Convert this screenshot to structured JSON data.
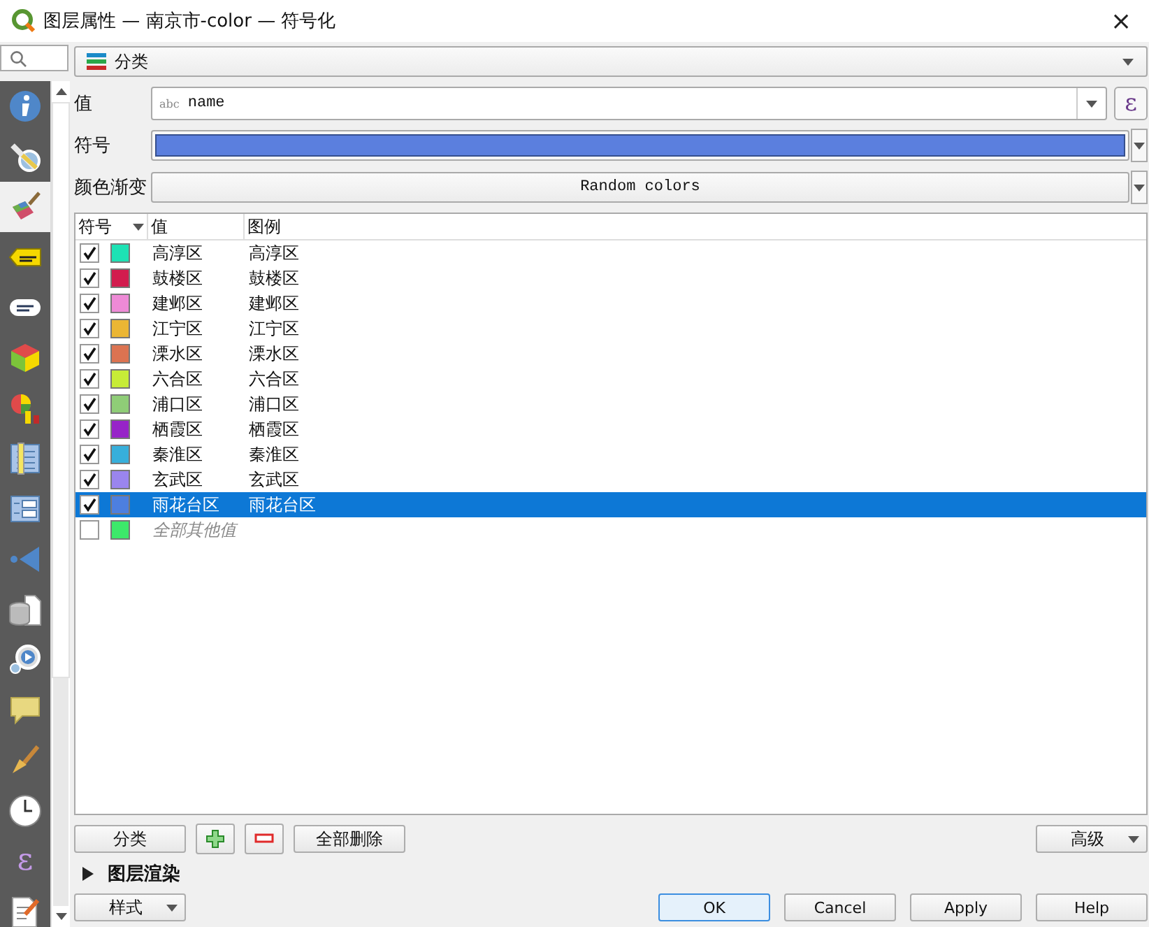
{
  "window": {
    "title": "图层属性 — 南京市-color — 符号化",
    "close": "×"
  },
  "sidebar": {
    "items": [
      {
        "selected": false
      },
      {
        "selected": false
      },
      {
        "selected": true
      },
      {
        "selected": false
      },
      {
        "selected": false
      },
      {
        "selected": false
      },
      {
        "selected": false
      },
      {
        "selected": false
      },
      {
        "selected": false
      },
      {
        "selected": false
      },
      {
        "selected": false
      },
      {
        "selected": false
      },
      {
        "selected": false
      },
      {
        "selected": false
      },
      {
        "selected": false
      },
      {
        "selected": false,
        "glyph": "ε"
      },
      {
        "selected": false
      }
    ]
  },
  "renderer": {
    "value": "分类"
  },
  "fields": {
    "value_label": "值",
    "value_type": "abc",
    "value": "name",
    "expression_button": "ε",
    "symbol_label": "符号",
    "ramp_label": "颜色渐变",
    "ramp": "Random colors"
  },
  "table": {
    "columns": [
      "符号",
      "值",
      "图例"
    ],
    "rows": [
      {
        "checked": true,
        "selected": false,
        "color": "#1de2b4",
        "value": "高淳区",
        "legend": "高淳区"
      },
      {
        "checked": true,
        "selected": false,
        "color": "#d21c4e",
        "value": "鼓楼区",
        "legend": "鼓楼区"
      },
      {
        "checked": true,
        "selected": false,
        "color": "#ee8ad6",
        "value": "建邺区",
        "legend": "建邺区"
      },
      {
        "checked": true,
        "selected": false,
        "color": "#ebb634",
        "value": "江宁区",
        "legend": "江宁区"
      },
      {
        "checked": true,
        "selected": false,
        "color": "#dc7351",
        "value": "溧水区",
        "legend": "溧水区"
      },
      {
        "checked": true,
        "selected": false,
        "color": "#c7ec37",
        "value": "六合区",
        "legend": "六合区"
      },
      {
        "checked": true,
        "selected": false,
        "color": "#8fcd77",
        "value": "浦口区",
        "legend": "浦口区"
      },
      {
        "checked": true,
        "selected": false,
        "color": "#9724c8",
        "value": "栖霞区",
        "legend": "栖霞区"
      },
      {
        "checked": true,
        "selected": false,
        "color": "#37afdb",
        "value": "秦淮区",
        "legend": "秦淮区"
      },
      {
        "checked": true,
        "selected": false,
        "color": "#9a85ee",
        "value": "玄武区",
        "legend": "玄武区"
      },
      {
        "checked": true,
        "selected": true,
        "color": "#4d7fdf",
        "value": "雨花台区",
        "legend": "雨花台区"
      },
      {
        "kind": "all-other",
        "checked": false,
        "selected": false,
        "color": "#3de86a",
        "value": "全部其他值"
      }
    ]
  },
  "actions": {
    "classify": "分类",
    "delete_all": "全部删除",
    "advanced": "高级"
  },
  "layer_rendering": {
    "label": "图层渲染",
    "expanded": false
  },
  "footer": {
    "style": "样式",
    "buttons": [
      "OK",
      "Cancel",
      "Apply",
      "Help"
    ]
  }
}
